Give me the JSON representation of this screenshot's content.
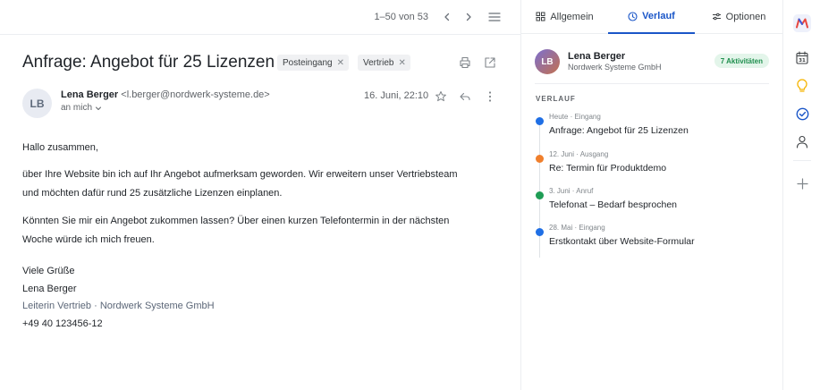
{
  "toolbar": {
    "pager": "1–50 von 53"
  },
  "message": {
    "subject": "Anfrage: Angebot für 25 Lizenzen",
    "labels": [
      "Posteingang",
      "Vertrieb"
    ],
    "sender": {
      "initials": "LB",
      "name": "Lena Berger",
      "email": "<l.berger@nordwerk-systeme.de>",
      "to": "an mich",
      "date": "16. Juni, 22:10"
    },
    "body": {
      "greeting": "Hallo zusammen,",
      "paragraph1_line1": "über Ihre Website bin ich auf Ihr Angebot aufmerksam geworden. Wir erweitern unser Vertriebsteam",
      "paragraph1_line2": "und möchten dafür rund 25 zusätzliche Lizenzen einplanen.",
      "paragraph2_line1": "Könnten Sie mir ein Angebot zukommen lassen? Über einen kurzen Telefontermin in der nächsten",
      "paragraph2_line2": "Woche würde ich mich freuen.",
      "closing": "Viele Grüße",
      "signature_name": "Lena Berger",
      "signature_role": "Leiterin Vertrieb · Nordwerk Systeme GmbH",
      "signature_phone": "+49 40 123456-12"
    }
  },
  "panel": {
    "tabs": [
      {
        "label": "Allgemein",
        "icon": "grid-icon"
      },
      {
        "label": "Verlauf",
        "icon": "clock-icon",
        "active": true
      },
      {
        "label": "Optionen",
        "icon": "sliders-icon"
      }
    ],
    "contact": {
      "initials": "LB",
      "name": "Lena Berger",
      "company": "Nordwerk Systeme GmbH",
      "badge": "7 Aktivitäten"
    },
    "section_title": "VERLAUF",
    "timeline": [
      {
        "meta": "Heute · Eingang",
        "title": "Anfrage: Angebot für 25 Lizenzen",
        "color": "#1f6fe5"
      },
      {
        "meta": "12. Juni · Ausgang",
        "title": "Re: Termin für Produktdemo",
        "color": "#f07f2c"
      },
      {
        "meta": "3. Juni · Anruf",
        "title": "Telefonat – Bedarf besprochen",
        "color": "#1f9d55"
      },
      {
        "meta": "28. Mai · Eingang",
        "title": "Erstkontakt über Website-Formular",
        "color": "#1f6fe5"
      }
    ]
  },
  "rail": {
    "icons": [
      "app-logo-icon",
      "calendar-icon",
      "lightbulb-icon",
      "tasks-check-icon",
      "contacts-icon",
      "add-icon"
    ],
    "calendar_day": "31"
  }
}
